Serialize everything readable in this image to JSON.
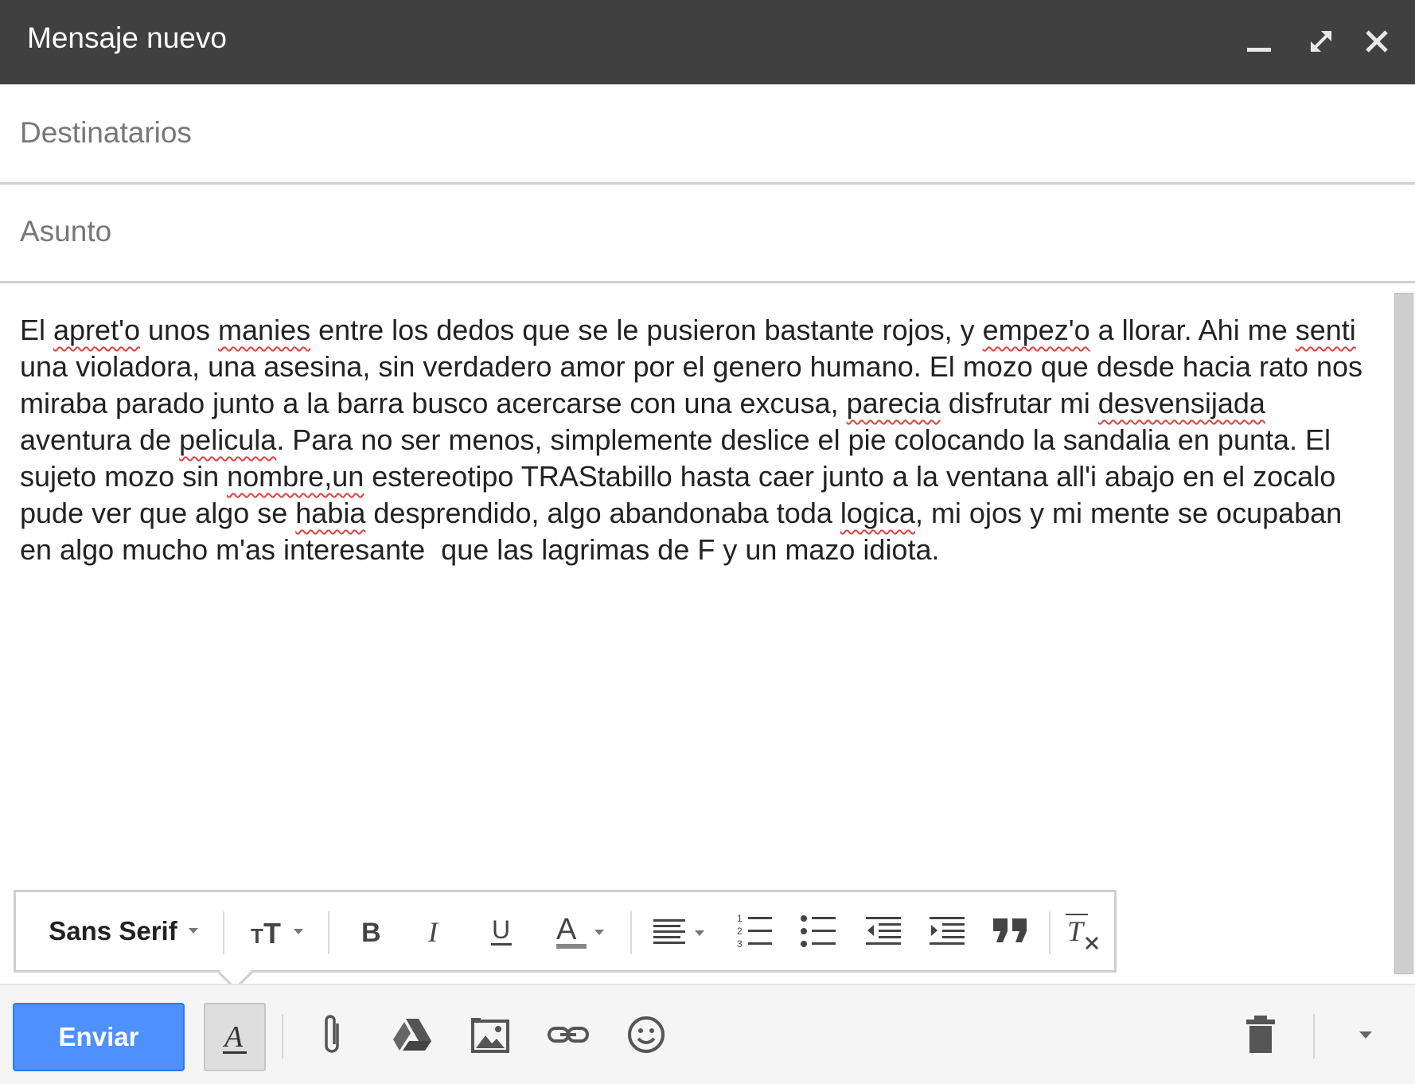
{
  "window": {
    "title": "Mensaje nuevo"
  },
  "recipients": {
    "label": "Destinatarios"
  },
  "subject": {
    "label": "Asunto"
  },
  "body": {
    "segments": [
      {
        "t": "El "
      },
      {
        "t": "apret'o",
        "sp": true
      },
      {
        "t": " unos "
      },
      {
        "t": "manies",
        "sp": true
      },
      {
        "t": " entre los dedos que se le pusieron bastante rojos, y "
      },
      {
        "t": "empez'o",
        "sp": true
      },
      {
        "t": " a llorar. Ahi me "
      },
      {
        "t": "senti",
        "sp": true
      },
      {
        "t": " una violadora, una asesina, sin verdadero amor por el genero humano. El mozo que desde hacia rato nos miraba parado junto a la barra busco acercarse con una excusa, "
      },
      {
        "t": "parecia",
        "sp": true
      },
      {
        "t": " disfrutar mi "
      },
      {
        "t": "desvensijada",
        "sp": true
      },
      {
        "t": " aventura de "
      },
      {
        "t": "pelicula",
        "sp": true
      },
      {
        "t": ". Para no ser menos, simplemente deslice el pie colocando la sandalia en punta. El sujeto mozo sin "
      },
      {
        "t": "nombre,un",
        "sp": true
      },
      {
        "t": " estereotipo TRAStabillo hasta caer junto a la ventana all'i abajo en el zocalo pude ver que algo se "
      },
      {
        "t": "habia",
        "sp": true
      },
      {
        "t": " desprendido, algo abandonaba toda "
      },
      {
        "t": "logica",
        "sp": true
      },
      {
        "t": ", mi ojos y mi mente se ocupaban en algo mucho m'as interesante  que las lagrimas de F y un mazo idiota."
      }
    ]
  },
  "format_toolbar": {
    "font": "Sans Serif"
  },
  "bottom_toolbar": {
    "send_label": "Enviar"
  },
  "colors": {
    "titlebar": "#404040",
    "send": "#4d90fe",
    "misspelling": "#e04040"
  }
}
